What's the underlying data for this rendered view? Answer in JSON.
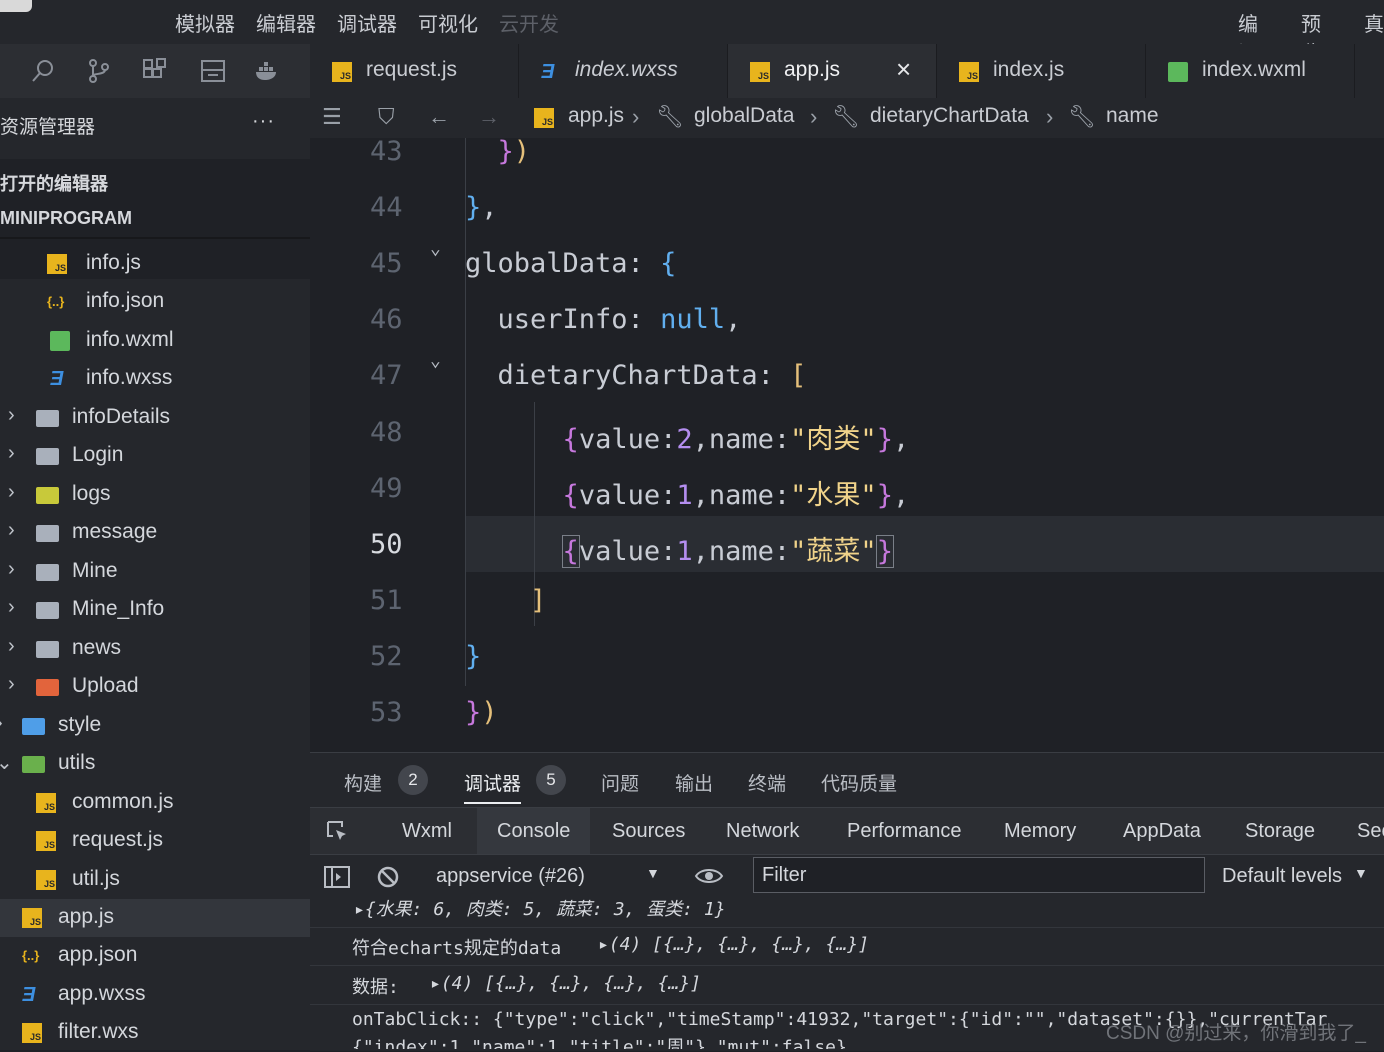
{
  "menu": {
    "items": [
      "模拟器",
      "编辑器",
      "调试器",
      "可视化",
      "云开发"
    ],
    "right": [
      "编译",
      "预览",
      "真"
    ]
  },
  "sidebar": {
    "title": "资源管理器",
    "more": "···",
    "sec_open": "打开的编辑器",
    "sec_project": "MINIPROGRAM",
    "items": [
      {
        "label": "info.js",
        "icon": "js-file-icon"
      },
      {
        "label": "info.json",
        "icon": "json-file-icon"
      },
      {
        "label": "info.wxml",
        "icon": "wxml-file-icon"
      },
      {
        "label": "info.wxss",
        "icon": "wxss-file-icon"
      },
      {
        "label": "infoDetails",
        "icon": "folder-icon"
      },
      {
        "label": "Login",
        "icon": "folder-icon"
      },
      {
        "label": "logs",
        "icon": "folder-logs-icon"
      },
      {
        "label": "message",
        "icon": "folder-icon"
      },
      {
        "label": "Mine",
        "icon": "folder-icon"
      },
      {
        "label": "Mine_Info",
        "icon": "folder-icon"
      },
      {
        "label": "news",
        "icon": "folder-icon"
      },
      {
        "label": "Upload",
        "icon": "folder-upload-icon"
      },
      {
        "label": "style",
        "icon": "folder-style-icon"
      },
      {
        "label": "utils",
        "icon": "folder-utils-icon"
      },
      {
        "label": "common.js",
        "icon": "js-file-icon"
      },
      {
        "label": "request.js",
        "icon": "js-file-icon"
      },
      {
        "label": "util.js",
        "icon": "js-file-icon"
      },
      {
        "label": "app.js",
        "icon": "js-file-icon"
      },
      {
        "label": "app.json",
        "icon": "json-file-icon"
      },
      {
        "label": "app.wxss",
        "icon": "wxss-file-icon"
      },
      {
        "label": "filter.wxs",
        "icon": "js-file-icon"
      }
    ]
  },
  "tabs": [
    {
      "label": "request.js",
      "icon": "js-file-icon"
    },
    {
      "label": "index.wxss",
      "icon": "wxss-file-icon"
    },
    {
      "label": "app.js",
      "icon": "js-file-icon",
      "active": true
    },
    {
      "label": "index.js",
      "icon": "js-file-icon"
    },
    {
      "label": "index.wxml",
      "icon": "wxml-file-icon"
    }
  ],
  "breadcrumb": [
    "app.js",
    "globalData",
    "dietaryChartData",
    "name"
  ],
  "editor": {
    "line_numbers": [
      "43",
      "44",
      "45",
      "46",
      "47",
      "48",
      "49",
      "50",
      "51",
      "52",
      "53"
    ],
    "current_line": "50"
  },
  "panel": {
    "tabs": [
      "构建",
      "调试器",
      "问题",
      "输出",
      "终端",
      "代码质量"
    ],
    "badges": {
      "build": "2",
      "debugger": "5"
    },
    "devtools_tabs": [
      "Wxml",
      "Console",
      "Sources",
      "Network",
      "Performance",
      "Memory",
      "AppData",
      "Storage",
      "Sec"
    ],
    "context": "appservice (#26)",
    "filter_placeholder": "Filter",
    "levels": "Default levels"
  },
  "console": {
    "log1": "▸{水果: 6, 肉类: 5, 蔬菜: 3, 蛋类: 1}",
    "log2_label": "符合echarts规定的data",
    "log2_value": "▸(4) [{…}, {…}, {…}, {…}]",
    "log3_label": "数据:",
    "log3_value": "▸(4) [{…}, {…}, {…}, {…}]",
    "log4": "onTabClick:: {\"type\":\"click\",\"timeStamp\":41932,\"target\":{\"id\":\"\",\"dataset\":{}},\"currentTar",
    "log5": "{\"index\":1,\"name\":1,\"title\":\"周\"},\"mut\":false}"
  },
  "watermark": "CSDN @别过来，你滑到我了_"
}
